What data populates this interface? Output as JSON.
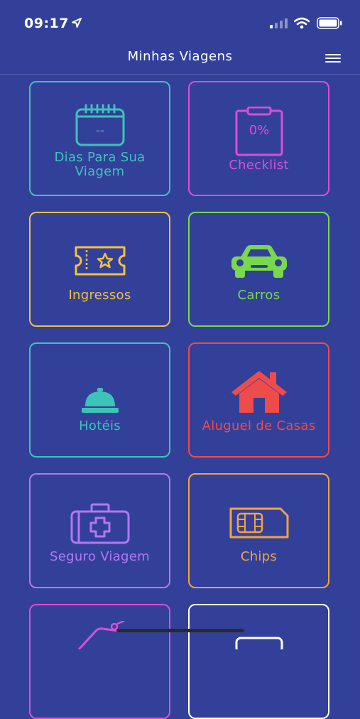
{
  "status_bar": {
    "time": "09:17"
  },
  "header": {
    "title": "Minhas Viagens"
  },
  "tiles": [
    {
      "label": "Dias Para Sua Viagem",
      "icon": "calendar-icon",
      "icon_text": "--",
      "color": "#3ec3b8"
    },
    {
      "label": "Checklist",
      "icon": "clipboard-icon",
      "icon_text": "0%",
      "color": "#d94fd6"
    },
    {
      "label": "Ingressos",
      "icon": "ticket-icon",
      "color": "#f2c13f"
    },
    {
      "label": "Carros",
      "icon": "car-icon",
      "color": "#79d94c"
    },
    {
      "label": "Hotéis",
      "icon": "service-bell-icon",
      "color": "#3ec3b8"
    },
    {
      "label": "Aluguel de Casas",
      "icon": "house-icon",
      "color": "#ee4b4b"
    },
    {
      "label": "Seguro Viagem",
      "icon": "medical-kit-icon",
      "color": "#b278f2"
    },
    {
      "label": "Chips",
      "icon": "sim-card-icon",
      "color": "#f2a33f"
    },
    {
      "label": "",
      "icon": "tag-icon",
      "color": "#d94fd6"
    },
    {
      "label": "",
      "icon": "tile-icon",
      "color": "#ffffff"
    }
  ]
}
